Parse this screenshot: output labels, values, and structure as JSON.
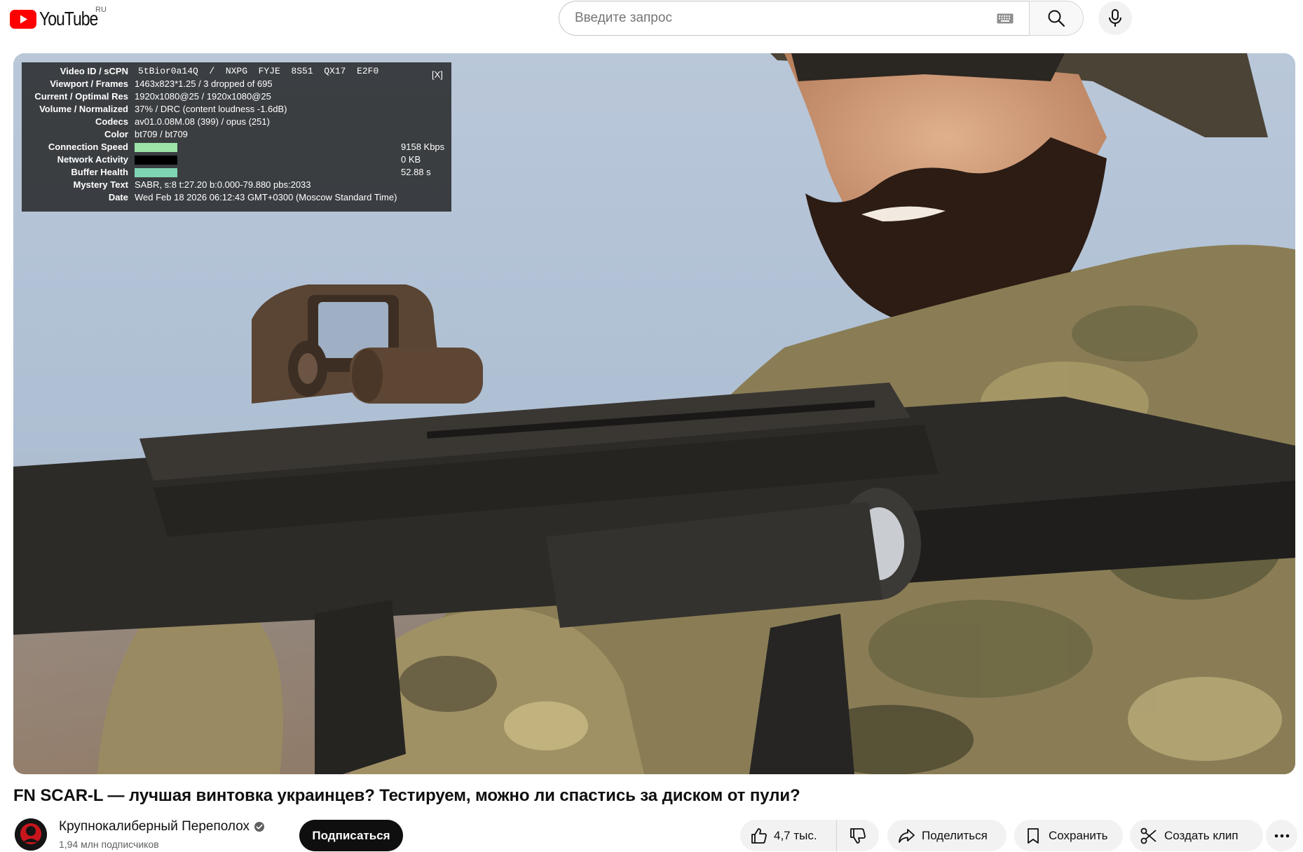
{
  "masthead": {
    "logo_text": "YouTube",
    "region": "RU",
    "search_placeholder": "Введите запрос",
    "icons": {
      "logo": "youtube-play-icon",
      "keyboard": "keyboard-icon",
      "search": "search-icon",
      "mic": "microphone-icon"
    }
  },
  "stats": {
    "close_label": "[X]",
    "rows": [
      {
        "label": "Video ID / sCPN",
        "value": "5tBior0a14Q  /  NXPG  FYJE  8S51  QX17  E2F0"
      },
      {
        "label": "Viewport / Frames",
        "value": "1463x823*1.25 / 3 dropped of 695"
      },
      {
        "label": "Current / Optimal Res",
        "value": "1920x1080@25 / 1920x1080@25"
      },
      {
        "label": "Volume / Normalized",
        "value": "37% / DRC (content loudness -1.6dB)"
      },
      {
        "label": "Codecs",
        "value": "av01.0.08M.08 (399) / opus (251)"
      },
      {
        "label": "Color",
        "value": "bt709 / bt709"
      },
      {
        "label": "Connection Speed",
        "value": "9158 Kbps"
      },
      {
        "label": "Network Activity",
        "value": "0 KB"
      },
      {
        "label": "Buffer Health",
        "value": "52.88 s"
      },
      {
        "label": "Mystery Text",
        "value": "SABR, s:8 t:27.20 b:0.000-79.880 pbs:2033"
      },
      {
        "label": "Date",
        "value": "Wed Feb 18 2026 06:12:43 GMT+0300 (Moscow Standard Time)"
      }
    ],
    "colors": {
      "connection_bar": "#9be3a7",
      "network_bar": "#000000",
      "buffer_bar": "#7fd4b4"
    }
  },
  "video": {
    "title": "FN SCAR-L — лучшая винтовка украинцев? Тестируем, можно ли спастись за диском от пули?"
  },
  "channel": {
    "name": "Крупнокалиберный Переполох",
    "subscribers": "1,94 млн подписчиков",
    "subscribe_label": "Подписаться",
    "verified_icon": "verified-check-icon"
  },
  "actions": {
    "likes": "4,7 тыс.",
    "share_label": "Поделиться",
    "save_label": "Сохранить",
    "clip_label": "Создать клип",
    "icons": [
      "thumbs-up-icon",
      "thumbs-down-icon",
      "share-arrow-icon",
      "bookmark-icon",
      "scissors-icon",
      "more-dots-icon"
    ]
  }
}
